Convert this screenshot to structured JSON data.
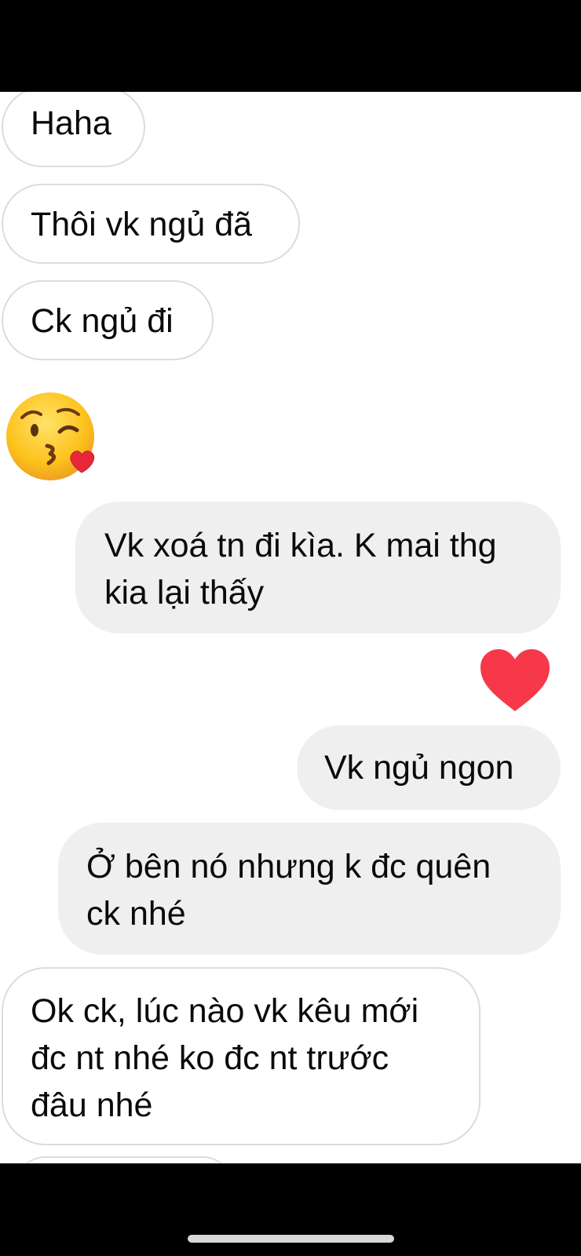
{
  "messages": [
    {
      "side": "received",
      "text": "Haha"
    },
    {
      "side": "received",
      "text": "Thôi vk ngủ đã"
    },
    {
      "side": "received",
      "text": "Ck ngủ đi"
    },
    {
      "side": "received",
      "type": "emoji",
      "icon": "face-blowing-kiss-emoji"
    },
    {
      "side": "sent",
      "line1": "Vk xoá tn đi kìa. K mai thg",
      "line2": "kia lại thấy"
    },
    {
      "side": "sent",
      "type": "reaction",
      "icon": "red-heart-icon",
      "color": "#f6384a"
    },
    {
      "side": "sent",
      "text": "Vk ngủ ngon"
    },
    {
      "side": "sent",
      "line1": "Ở bên nó nhưng k đc quên",
      "line2": "ck nhé"
    },
    {
      "side": "received",
      "line1": "Ok ck, lúc nào vk kêu mới",
      "line2": "đc nt nhé ko đc nt trước",
      "line3": "đâu nhé"
    }
  ],
  "colors": {
    "sent_bubble": "#efefef",
    "received_border": "#dcdcdc",
    "heart": "#f6384a"
  }
}
